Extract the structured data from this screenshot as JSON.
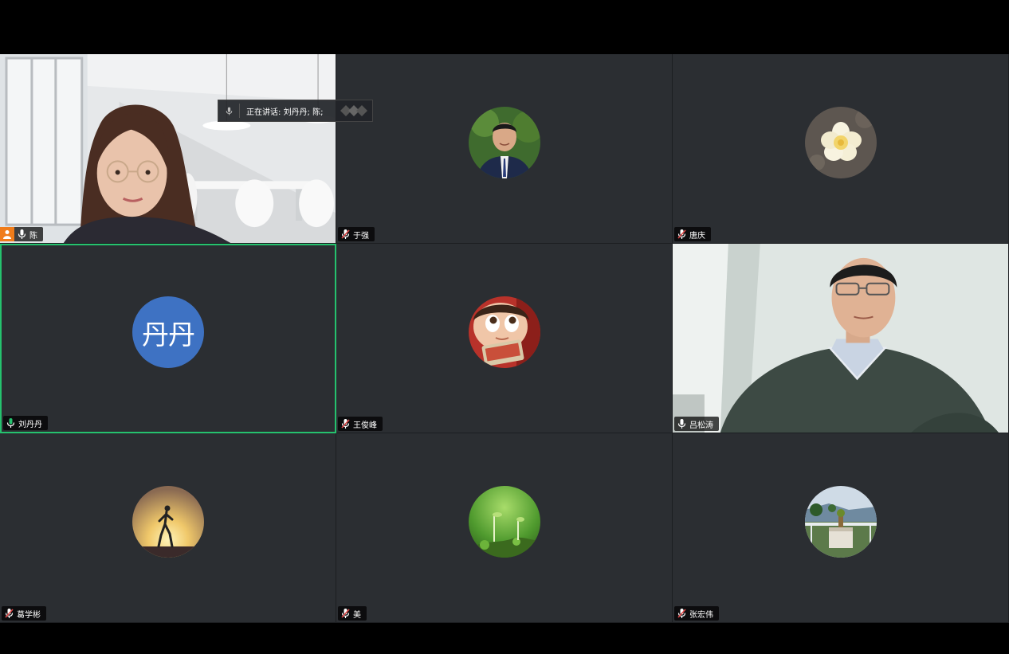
{
  "speaking_indicator": {
    "prefix": "正在讲话:",
    "names": "刘丹丹; 陈;"
  },
  "participants": [
    {
      "name": "陈",
      "type": "video",
      "host": true,
      "mic": "on"
    },
    {
      "name": "于强",
      "type": "avatar-photo",
      "mic": "muted"
    },
    {
      "name": "唐庆",
      "type": "avatar-photo",
      "mic": "muted"
    },
    {
      "name": "刘丹丹",
      "type": "avatar-text",
      "avatar_text": "丹丹",
      "avatar_color": "#3e72c3",
      "mic": "speaking",
      "active": true
    },
    {
      "name": "王俊峰",
      "type": "avatar-photo",
      "mic": "muted"
    },
    {
      "name": "吕松涛",
      "type": "video",
      "mic": "on"
    },
    {
      "name": "葛学彬",
      "type": "avatar-photo",
      "mic": "muted"
    },
    {
      "name": "美",
      "type": "avatar-photo",
      "mic": "muted"
    },
    {
      "name": "张宏伟",
      "type": "avatar-photo",
      "mic": "muted"
    }
  ],
  "colors": {
    "active_border": "#25c26e",
    "host_badge": "#f07c1a",
    "tile_bg": "#2b2e32",
    "muted_mic": "#e04848"
  }
}
